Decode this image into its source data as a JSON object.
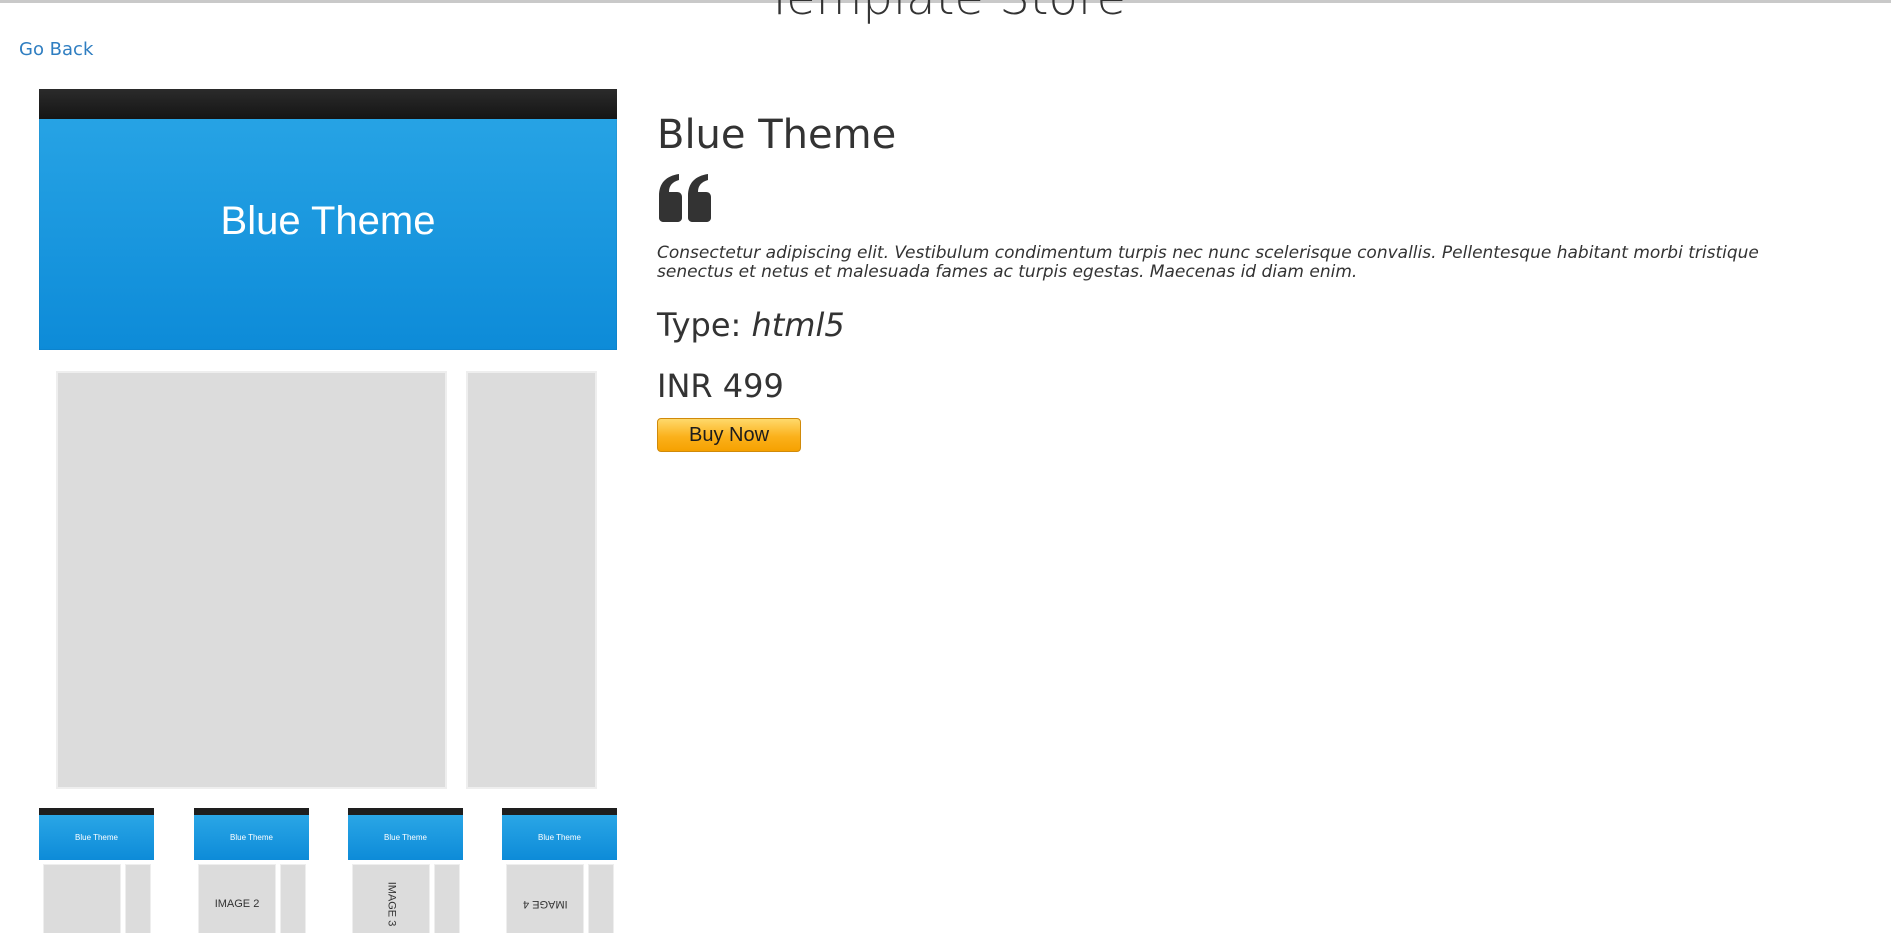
{
  "header": {
    "site_title": "Template Store",
    "go_back_label": "Go Back"
  },
  "preview": {
    "main_title": "Blue Theme",
    "thumbnails": [
      {
        "title": "Blue Theme",
        "image_label": ""
      },
      {
        "title": "Blue Theme",
        "image_label": "IMAGE 2"
      },
      {
        "title": "Blue Theme",
        "image_label": "IMAGE 3"
      },
      {
        "title": "Blue Theme",
        "image_label": "IMAGE 4"
      }
    ]
  },
  "product": {
    "name": "Blue Theme",
    "quote_icon": "quote-left-icon",
    "description": "Consectetur adipiscing elit. Vestibulum condimentum turpis nec nunc scelerisque convallis. Pellentesque habitant morbi tristique senectus et netus et malesuada fames ac turpis egestas. Maecenas id diam enim.",
    "type_label": "Type:",
    "type_value": "html5",
    "price": "INR 499",
    "buy_label": "Buy Now"
  },
  "colors": {
    "link": "#2f7ec1",
    "theme_blue": "#1a9ae0",
    "buy_button": "#fbb11c"
  }
}
